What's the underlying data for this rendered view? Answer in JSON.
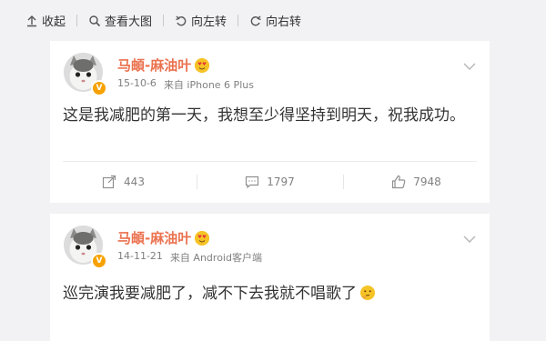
{
  "toolbar": {
    "collapse_label": "收起",
    "view_large_label": "查看大图",
    "rotate_left_label": "向左转",
    "rotate_right_label": "向右转"
  },
  "posts": [
    {
      "author": "马頔-麻油叶",
      "date": "15-10-6",
      "source": "来自 iPhone 6 Plus",
      "text": "这是我减肥的第一天，我想至少得坚持到明天，祝我成功。",
      "reposts": "443",
      "comments": "1797",
      "likes": "7948"
    },
    {
      "author": "马頔-麻油叶",
      "date": "14-11-21",
      "source": "来自 Android客户端",
      "text": "巡完演我要减肥了，减不下去我就不唱歌了"
    }
  ],
  "colors": {
    "author_name": "#eb7350",
    "background": "#f2f2f5",
    "verified_badge": "#f7a200"
  }
}
